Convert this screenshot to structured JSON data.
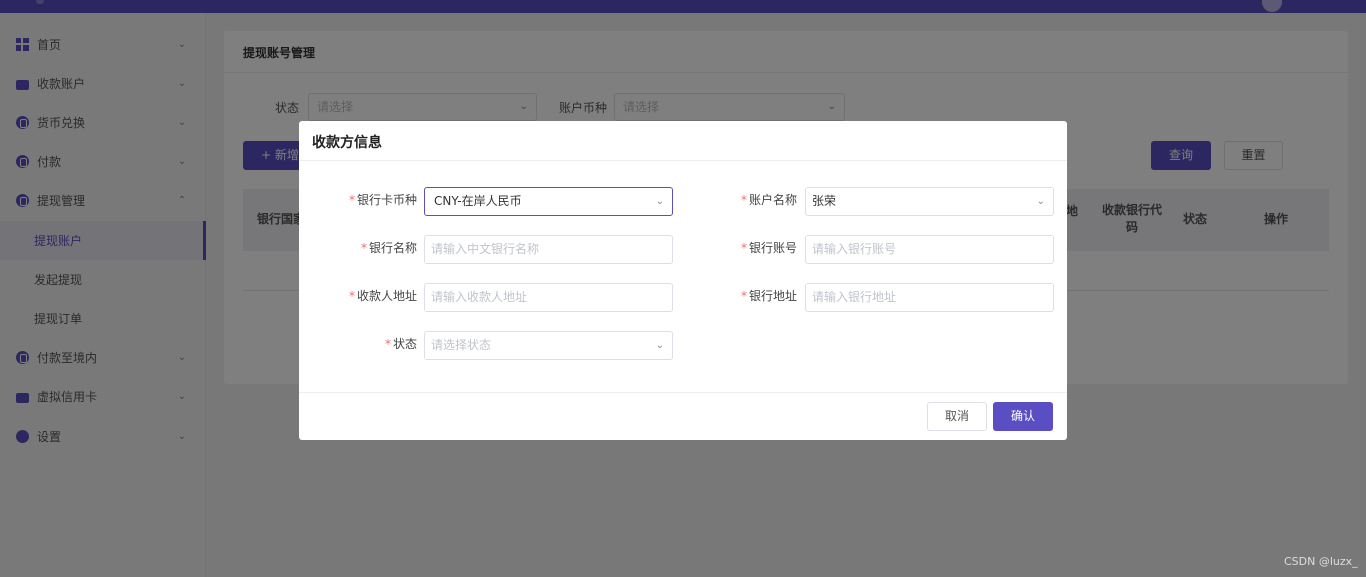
{
  "colors": {
    "primary": "#5a4ec2",
    "required": "#f56c6c"
  },
  "sidebar": {
    "items": [
      {
        "label": "首页",
        "icon": "grid-icon"
      },
      {
        "label": "收款账户",
        "icon": "wallet-icon"
      },
      {
        "label": "货币兑换",
        "icon": "exchange-icon"
      },
      {
        "label": "付款",
        "icon": "payment-icon"
      },
      {
        "label": "提现管理",
        "icon": "withdraw-icon",
        "expanded": true
      },
      {
        "label": "付款至境内",
        "icon": "domestic-icon"
      },
      {
        "label": "虚拟信用卡",
        "icon": "card-icon"
      },
      {
        "label": "设置",
        "icon": "gear-icon"
      }
    ],
    "sub_items": [
      {
        "label": "提现账户",
        "active": true
      },
      {
        "label": "发起提现"
      },
      {
        "label": "提现订单"
      }
    ]
  },
  "main": {
    "title": "提现账号管理",
    "filters": {
      "status_label": "状态",
      "status_placeholder": "请选择",
      "currency_label": "账户币种",
      "currency_placeholder": "请选择"
    },
    "add_button": "+ 新增",
    "query_button": "查询",
    "reset_button": "重置",
    "table_headers": {
      "col1": "银行国家",
      "col_partial": "地",
      "bank_code": "收款银行代码",
      "status": "状态",
      "actions": "操作"
    }
  },
  "modal": {
    "title": "收款方信息",
    "fields": {
      "card_currency": {
        "label": "银行卡币种",
        "value": "CNY-在岸人民币"
      },
      "account_name": {
        "label": "账户名称",
        "value": "张荣"
      },
      "bank_name": {
        "label": "银行名称",
        "placeholder": "请输入中文银行名称"
      },
      "bank_account": {
        "label": "银行账号",
        "placeholder": "请输入银行账号"
      },
      "payee_address": {
        "label": "收款人地址",
        "placeholder": "请输入收款人地址"
      },
      "bank_address": {
        "label": "银行地址",
        "placeholder": "请输入银行地址"
      },
      "status": {
        "label": "状态",
        "placeholder": "请选择状态"
      }
    },
    "cancel": "取消",
    "confirm": "确认"
  },
  "watermark": "CSDN @luzx_"
}
